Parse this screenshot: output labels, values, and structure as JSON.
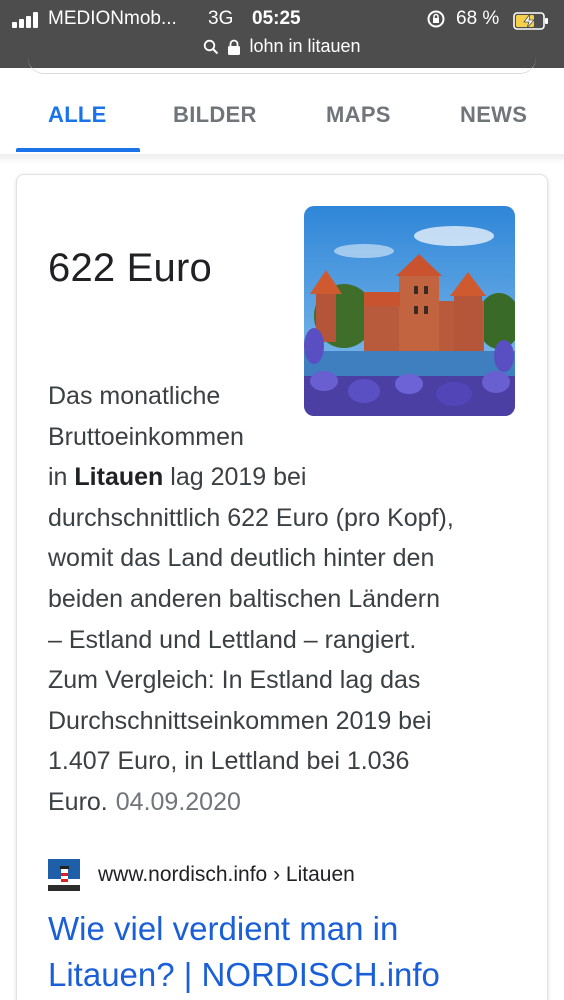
{
  "status_bar": {
    "carrier": "MEDIONmob...",
    "network": "3G",
    "time": "05:25",
    "battery_percent": "68 %",
    "url": "lohn in litauen"
  },
  "tabs": [
    {
      "label": "ALLE",
      "active": true
    },
    {
      "label": "BILDER",
      "active": false
    },
    {
      "label": "MAPS",
      "active": false
    },
    {
      "label": "NEWS",
      "active": false
    }
  ],
  "answer": {
    "title": "622 Euro",
    "snippet_lines": [
      "Das monatliche",
      "Bruttoeinkommen",
      "in ",
      "Litauen",
      " lag 2019 bei",
      "durchschnittlich 622 Euro (pro Kopf),",
      "womit das Land deutlich hinter den",
      "beiden anderen baltischen Ländern",
      "– Estland und Lettland – rangiert.",
      "Zum Vergleich: In Estland lag das",
      "Durchschnittseinkommen 2019 bei",
      "1.407 Euro, in Lettland bei 1.036",
      "Euro."
    ],
    "date": "04.09.2020",
    "image_icon": "castle-photo"
  },
  "source": {
    "url": "www.nordisch.info › Litauen",
    "favicon_icon": "lighthouse-icon"
  },
  "result": {
    "title_line1": "Wie viel verdient man in",
    "title_line2": "Litauen? | NORDISCH.info"
  },
  "colors": {
    "accent": "#1a73e8",
    "status_bar_bg": "#4d4d4d",
    "link": "#1a5fd8"
  }
}
